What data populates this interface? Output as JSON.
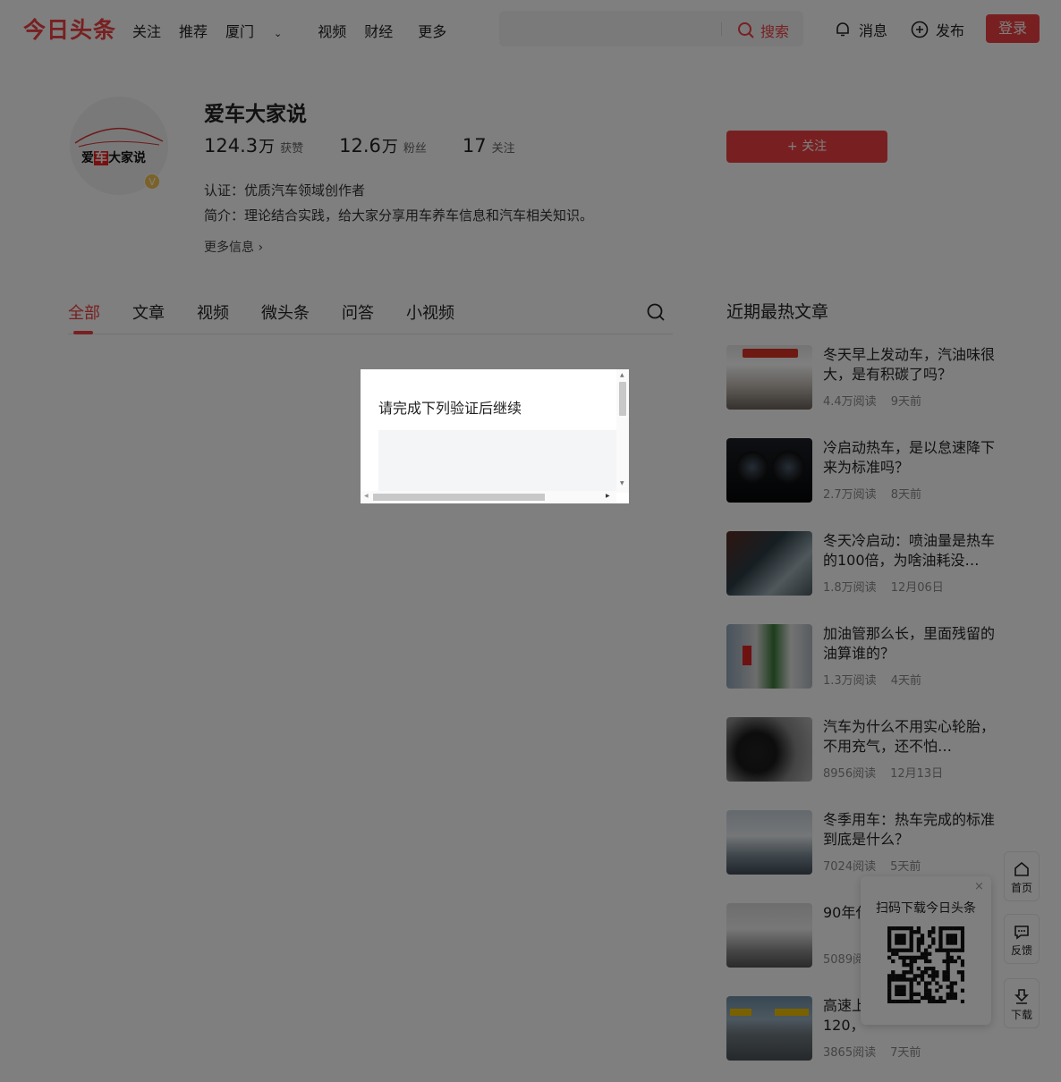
{
  "header": {
    "logo": "今日头条",
    "nav": [
      "关注",
      "推荐",
      "厦门",
      "视频",
      "财经"
    ],
    "nav_more": "更多",
    "search_button": "搜索",
    "messages": "消息",
    "publish": "发布",
    "login": "登录"
  },
  "profile": {
    "name": "爱车大家说",
    "avatar_text_prefix": "爱",
    "avatar_text_highlight": "车",
    "avatar_text_suffix": "大家说",
    "badge": "V",
    "likes_num": "124.3",
    "likes_unit": "万",
    "likes_label": "获赞",
    "fans_num": "12.6",
    "fans_unit": "万",
    "fans_label": "粉丝",
    "following_num": "17",
    "following_label": "关注",
    "follow_button": "+ 关注",
    "certification": "认证：优质汽车领域创作者",
    "intro": "简介：理论结合实践，给大家分享用车养车信息和汽车相关知识。",
    "more_info": "更多信息 ›"
  },
  "tabs": [
    "全部",
    "文章",
    "视频",
    "微头条",
    "问答",
    "小视频"
  ],
  "hot": {
    "title": "近期最热文章",
    "articles": [
      {
        "title": "冬天早上发动车，汽油味很大，是有积碳了吗？",
        "reads": "4.4万阅读",
        "time": "9天前"
      },
      {
        "title": "冷启动热车，是以怠速降下来为标准吗？",
        "reads": "2.7万阅读",
        "time": "8天前"
      },
      {
        "title": "冬天冷启动：喷油量是热车的100倍，为啥油耗没…",
        "reads": "1.8万阅读",
        "time": "12月06日"
      },
      {
        "title": "加油管那么长，里面残留的油算谁的？",
        "reads": "1.3万阅读",
        "time": "4天前"
      },
      {
        "title": "汽车为什么不用实心轮胎，不用充气，还不怕…",
        "reads": "8956阅读",
        "time": "12月13日"
      },
      {
        "title": "冬季用车：热车完成的标准到底是什么？",
        "reads": "7024阅读",
        "time": "5天前"
      },
      {
        "title": "90年代 雾灯，",
        "reads": "5089阅读",
        "time": ""
      },
      {
        "title": "高速上 里，时速100和120，",
        "reads": "3865阅读",
        "time": "7天前"
      }
    ]
  },
  "side_tools": {
    "home": "首页",
    "feedback": "反馈",
    "download": "下载"
  },
  "qr_popup": {
    "title": "扫码下载今日头条",
    "close": "×"
  },
  "modal": {
    "title": "请完成下列验证后继续"
  }
}
